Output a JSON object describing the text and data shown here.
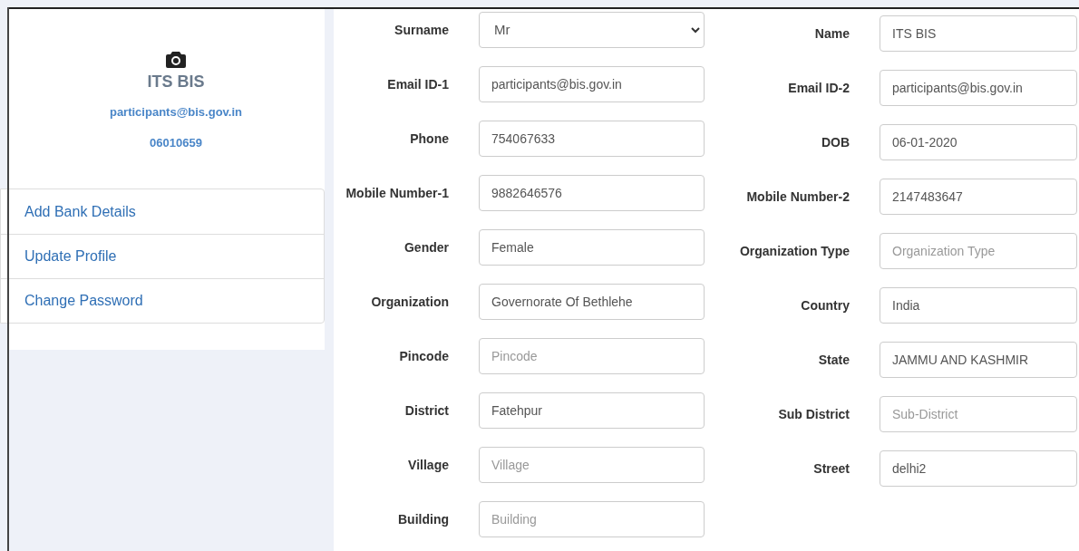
{
  "profile": {
    "name": "ITS BIS",
    "email": "participants@bis.gov.in",
    "id": "06010659"
  },
  "menu": [
    {
      "label": "Add Bank Details"
    },
    {
      "label": "Update Profile"
    },
    {
      "label": "Change Password"
    }
  ],
  "form": {
    "left": [
      {
        "label": "Surname",
        "kind": "select",
        "value": "Mr"
      },
      {
        "label": "Email ID-1",
        "kind": "input",
        "value": "participants@bis.gov.in"
      },
      {
        "label": "Phone",
        "kind": "input",
        "value": "754067633"
      },
      {
        "label": "Mobile Number-1",
        "kind": "input",
        "value": "9882646576"
      },
      {
        "label": "Gender",
        "kind": "input",
        "value": "Female"
      },
      {
        "label": "Organization",
        "kind": "input",
        "value": "Governorate Of Bethlehe"
      },
      {
        "label": "Pincode",
        "kind": "input",
        "placeholder": "Pincode"
      },
      {
        "label": "District",
        "kind": "input",
        "value": "Fatehpur"
      },
      {
        "label": "Village",
        "kind": "input",
        "placeholder": "Village"
      },
      {
        "label": "Building",
        "kind": "input",
        "placeholder": "Building"
      }
    ],
    "right": [
      {
        "label": "Name",
        "kind": "input",
        "value": "ITS BIS"
      },
      {
        "label": "Email ID-2",
        "kind": "input",
        "value": "participants@bis.gov.in"
      },
      {
        "label": "DOB",
        "kind": "input",
        "value": "06-01-2020"
      },
      {
        "label": "Mobile Number-2",
        "kind": "input",
        "value": "2147483647"
      },
      {
        "label": "Organization Type",
        "kind": "input",
        "placeholder": "Organization Type"
      },
      {
        "label": "Country",
        "kind": "input",
        "value": "India"
      },
      {
        "label": "State",
        "kind": "input",
        "value": "JAMMU AND KASHMIR"
      },
      {
        "label": "Sub District",
        "kind": "input",
        "placeholder": "Sub-District"
      },
      {
        "label": "Street",
        "kind": "input",
        "value": "delhi2"
      }
    ]
  }
}
